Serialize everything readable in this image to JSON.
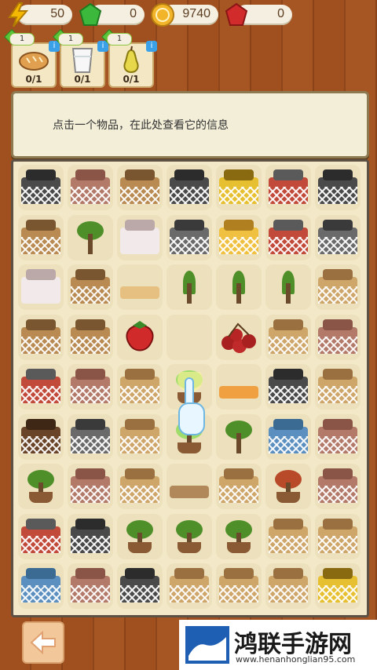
{
  "resources": [
    {
      "id": "energy",
      "icon": "lightning-bolt-icon",
      "value": "50",
      "color": "#f5b800"
    },
    {
      "id": "green-gem",
      "icon": "green-gem-icon",
      "value": "0",
      "color": "#3cb93c"
    },
    {
      "id": "coin",
      "icon": "gold-coin-icon",
      "value": "9740",
      "color": "#f2b52a"
    },
    {
      "id": "red-gem",
      "icon": "red-gem-icon",
      "value": "0",
      "color": "#d22b2b"
    }
  ],
  "inventory": [
    {
      "icon": "bread-icon",
      "level": "1",
      "count": "0/1"
    },
    {
      "icon": "milk-glass-icon",
      "level": "1",
      "count": "0/1"
    },
    {
      "icon": "pear-icon",
      "level": "1",
      "count": "0/1"
    }
  ],
  "info_text": "点击一个物品，在此处查看它的信息",
  "grid": [
    [
      "box-dark",
      "box-brick",
      "bucket",
      "box-dark",
      "handle-yellow",
      "box-red",
      "box-dark"
    ],
    [
      "bucket-tall",
      "sapling",
      "milk-carton",
      "box-gray",
      "box-yellow",
      "box-red",
      "box-gray"
    ],
    [
      "milk-carton",
      "bucket-tall",
      "plank",
      "sprout",
      "sprout",
      "sprout",
      "crate-glass"
    ],
    [
      "bucket-tall",
      "bucket-tall",
      "strawberry",
      "empty",
      "cherries",
      "crate-glass",
      "box-brick"
    ],
    [
      "box-red",
      "box-brick",
      "crate-glass",
      "tree-glow",
      "plank-orange",
      "box-dark",
      "crate-glass"
    ],
    [
      "bucket-dirt",
      "box-gray",
      "crate-glass",
      "tree-glow",
      "sapling",
      "box-blue",
      "box-brick"
    ],
    [
      "bonsai",
      "box-brick",
      "crate-glass",
      "plank-brown",
      "crate-glass",
      "apple-tree",
      "box-brick"
    ],
    [
      "box-red",
      "box-dark",
      "bonsai",
      "bonsai",
      "tree-round",
      "crate-glass",
      "crate-glass"
    ],
    [
      "box-blue",
      "box-brick",
      "box-dark",
      "crate-glass",
      "crate-glass",
      "crate-glass",
      "handle-yellow"
    ]
  ],
  "back_icon": "back-arrow-icon",
  "watermark": {
    "title": "鸿联手游网",
    "url": "www.henanhonglian95.com"
  }
}
